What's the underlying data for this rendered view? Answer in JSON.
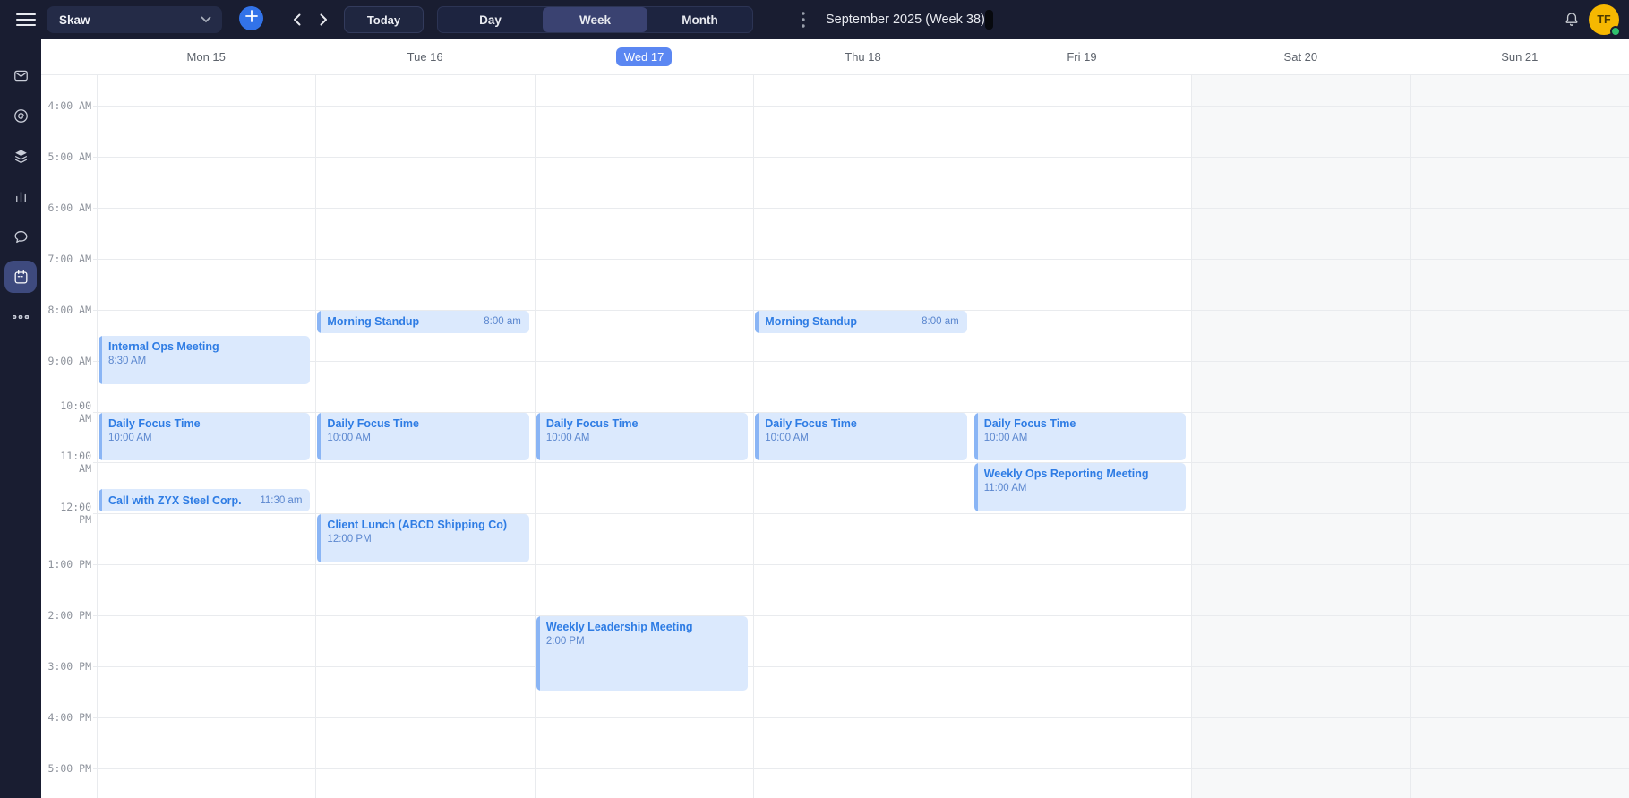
{
  "topbar": {
    "calendar_selector_label": "Skaw",
    "today_label": "Today",
    "view_tabs": [
      "Day",
      "Week",
      "Month"
    ],
    "active_view": "Week",
    "title": "September 2025 (Week 38)",
    "avatar_initials": "TF"
  },
  "sidebar": {
    "items": [
      "mail",
      "focus",
      "layers",
      "analytics",
      "chat",
      "calendar",
      "more"
    ],
    "active_item": "calendar"
  },
  "calendar": {
    "times": [
      "4:00 AM",
      "5:00 AM",
      "6:00 AM",
      "7:00 AM",
      "8:00 AM",
      "9:00 AM",
      "10:00 AM",
      "11:00 AM",
      "12:00 PM",
      "1:00 PM",
      "2:00 PM",
      "3:00 PM",
      "4:00 PM",
      "5:00 PM"
    ],
    "days": [
      {
        "label": "Mon 15",
        "today": false,
        "weekend": false,
        "events": [
          {
            "title": "Internal Ops Meeting",
            "time": "8:30 AM",
            "start": 8.5,
            "duration": 1,
            "layout": "stacked"
          },
          {
            "title": "Daily Focus Time",
            "time": "10:00 AM",
            "start": 10,
            "duration": 1,
            "layout": "stacked"
          },
          {
            "title": "Call with ZYX Steel Corp.",
            "time": "11:30 am",
            "start": 11.5,
            "duration": 0.5,
            "layout": "inline"
          }
        ]
      },
      {
        "label": "Tue 16",
        "today": false,
        "weekend": false,
        "events": [
          {
            "title": "Morning Standup",
            "time": "8:00 am",
            "start": 8,
            "duration": 0.5,
            "layout": "inline"
          },
          {
            "title": "Daily Focus Time",
            "time": "10:00 AM",
            "start": 10,
            "duration": 1,
            "layout": "stacked"
          },
          {
            "title": "Client Lunch (ABCD Shipping Co)",
            "time": "12:00 PM",
            "start": 12,
            "duration": 1,
            "layout": "stacked"
          }
        ]
      },
      {
        "label": "Wed 17",
        "today": true,
        "weekend": false,
        "events": [
          {
            "title": "Daily Focus Time",
            "time": "10:00 AM",
            "start": 10,
            "duration": 1,
            "layout": "stacked"
          },
          {
            "title": "Weekly Leadership Meeting",
            "time": "2:00 PM",
            "start": 14,
            "duration": 1.5,
            "layout": "stacked"
          }
        ]
      },
      {
        "label": "Thu 18",
        "today": false,
        "weekend": false,
        "events": [
          {
            "title": "Morning Standup",
            "time": "8:00 am",
            "start": 8,
            "duration": 0.5,
            "layout": "inline"
          },
          {
            "title": "Daily Focus Time",
            "time": "10:00 AM",
            "start": 10,
            "duration": 1,
            "layout": "stacked"
          }
        ]
      },
      {
        "label": "Fri 19",
        "today": false,
        "weekend": false,
        "events": [
          {
            "title": "Daily Focus Time",
            "time": "10:00 AM",
            "start": 10,
            "duration": 1,
            "layout": "stacked"
          },
          {
            "title": "Weekly Ops Reporting Meeting",
            "time": "11:00 AM",
            "start": 11,
            "duration": 1,
            "layout": "stacked"
          }
        ]
      },
      {
        "label": "Sat 20",
        "today": false,
        "weekend": true,
        "events": []
      },
      {
        "label": "Sun 21",
        "today": false,
        "weekend": true,
        "events": []
      }
    ]
  },
  "colors": {
    "topbar_bg": "#191d31",
    "accent_blue": "#3273e9",
    "active_view_bg": "#3a4271",
    "selected_day_bg": "#5b87f2",
    "event_bg": "#dbe9fd",
    "event_accent": "#8ab5f5",
    "event_title": "#2e7ce4",
    "event_time": "#5b87cf",
    "weekend_bg": "#f7f8f9",
    "avatar_bg": "#f6b801",
    "presence_green": "#2fc16d"
  }
}
